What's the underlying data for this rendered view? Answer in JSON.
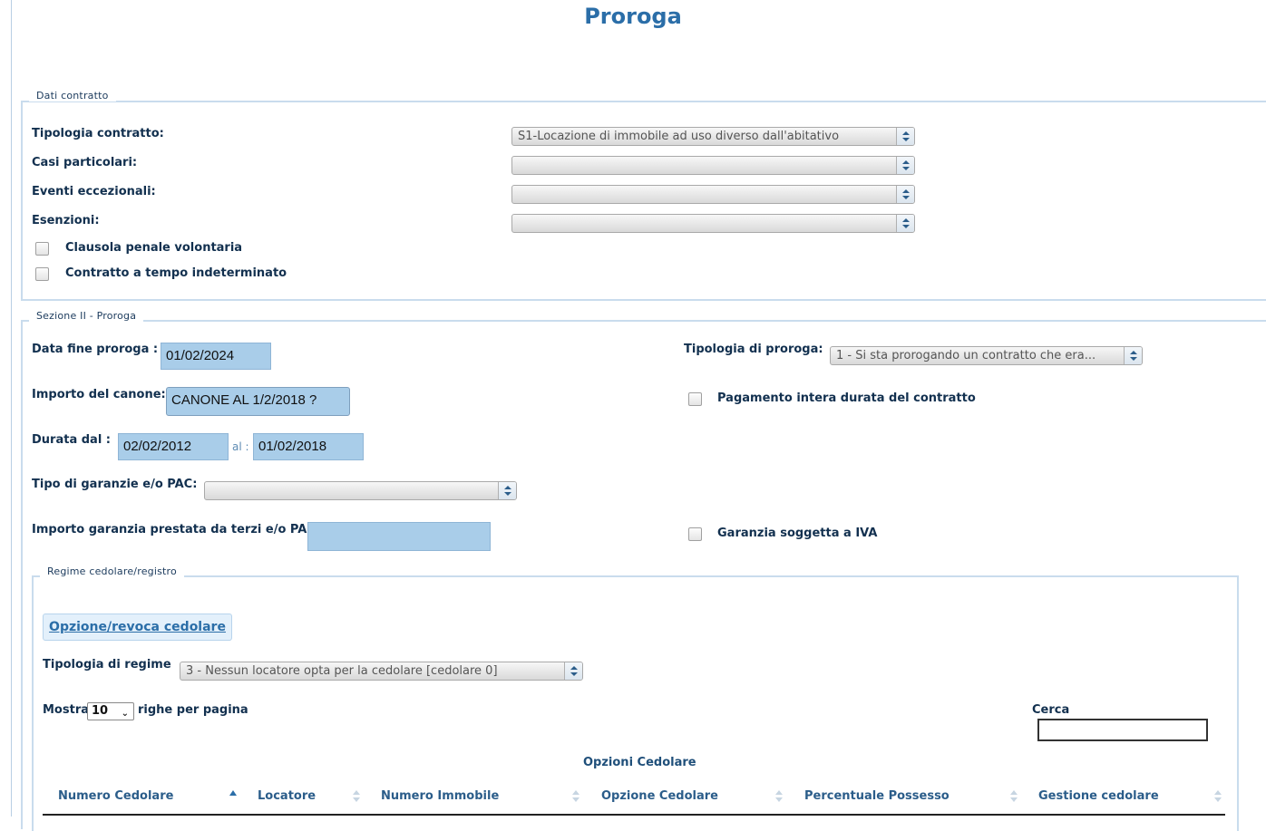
{
  "page": {
    "title": "Proroga"
  },
  "dati_contratto": {
    "legend": "Dati contratto",
    "tipologia_label": "Tipologia contratto:",
    "tipologia_value": "S1-Locazione di immobile ad uso diverso dall'abitativo",
    "casi_label": "Casi particolari:",
    "casi_value": "",
    "eventi_label": "Eventi eccezionali:",
    "eventi_value": "",
    "esenzioni_label": "Esenzioni:",
    "esenzioni_value": "",
    "clausola_label": "Clausola penale volontaria",
    "clausola_checked": false,
    "indeterminato_label": "Contratto a tempo indeterminato",
    "indeterminato_checked": false
  },
  "sezione_proroga": {
    "legend": "Sezione II - Proroga",
    "data_fine_label": "Data fine proroga :",
    "data_fine_value": "01/02/2024",
    "tipologia_proroga_label": "Tipologia di proroga:",
    "tipologia_proroga_value": "1 - Si sta prorogando un contratto che era...",
    "importo_canone_label": "Importo del canone:",
    "importo_canone_value": "CANONE AL 1/2/2018 ?",
    "pagamento_intera_label": "Pagamento intera durata del contratto",
    "pagamento_intera_checked": false,
    "durata_label": "Durata dal :",
    "durata_dal_value": "02/02/2012",
    "al_label": "al :",
    "durata_al_value": "01/02/2018",
    "tipo_garanzie_label": "Tipo di garanzie e/o PAC:",
    "tipo_garanzie_value": "",
    "importo_garanzia_label": "Importo garanzia prestata da terzi e/o PAC:",
    "importo_garanzia_value": "",
    "garanzia_iva_label": "Garanzia soggetta a IVA",
    "garanzia_iva_checked": false
  },
  "regime": {
    "legend": "Regime cedolare/registro",
    "opzione_button": "Opzione/revoca cedolare",
    "tipologia_regime_label": "Tipologia di regime",
    "tipologia_regime_value": "3 - Nessun locatore opta per la cedolare [cedolare 0]",
    "mostra_label": "Mostra",
    "mostra_value": "10",
    "righe_label": "righe per pagina",
    "cerca_label": "Cerca",
    "cerca_value": "",
    "table_caption": "Opzioni Cedolare",
    "columns": [
      "Numero Cedolare",
      "Locatore",
      "Numero Immobile",
      "Opzione Cedolare",
      "Percentuale Possesso",
      "Gestione cedolare"
    ]
  }
}
